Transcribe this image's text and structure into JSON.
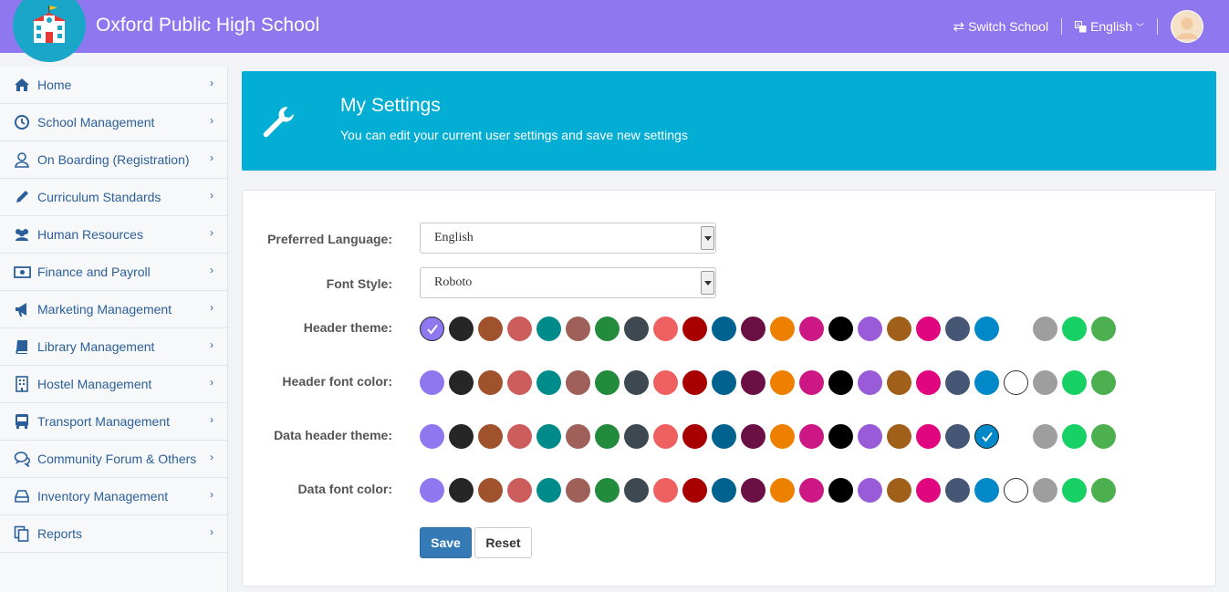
{
  "header": {
    "school_name": "Oxford Public High School",
    "switch_school": "Switch School",
    "language": "English"
  },
  "sidebar": {
    "items": [
      {
        "label": "Home",
        "icon": "home-icon"
      },
      {
        "label": "School Management",
        "icon": "clock-icon"
      },
      {
        "label": "On Boarding (Registration)",
        "icon": "user-icon"
      },
      {
        "label": "Curriculum Standards",
        "icon": "pencil-icon"
      },
      {
        "label": "Human Resources",
        "icon": "users-icon"
      },
      {
        "label": "Finance and Payroll",
        "icon": "money-icon"
      },
      {
        "label": "Marketing Management",
        "icon": "bullhorn-icon"
      },
      {
        "label": "Library Management",
        "icon": "book-icon"
      },
      {
        "label": "Hostel Management",
        "icon": "building-icon"
      },
      {
        "label": "Transport Management",
        "icon": "bus-icon"
      },
      {
        "label": "Community Forum & Others",
        "icon": "comments-icon"
      },
      {
        "label": "Inventory Management",
        "icon": "hdd-icon"
      },
      {
        "label": "Reports",
        "icon": "copy-icon"
      }
    ]
  },
  "banner": {
    "title": "My Settings",
    "subtitle": "You can edit your current user settings and save new settings"
  },
  "form": {
    "language_label": "Preferred Language:",
    "language_value": "English",
    "font_label": "Font Style:",
    "font_value": "Roboto",
    "rows": [
      {
        "label": "Header theme:",
        "selected": 0,
        "has_white": false
      },
      {
        "label": "Header font color:",
        "selected": -1,
        "has_white": true
      },
      {
        "label": "Data header theme:",
        "selected": 19,
        "has_white": false
      },
      {
        "label": "Data font color:",
        "selected": -1,
        "has_white": true
      }
    ],
    "save_label": "Save",
    "reset_label": "Reset"
  },
  "palette": [
    "#8f78ef",
    "#262626",
    "#a0522d",
    "#cd5c5c",
    "#008b8b",
    "#a0605a",
    "#228b3c",
    "#3d4850",
    "#ef6060",
    "#a80000",
    "#00628f",
    "#6b1045",
    "#ee8000",
    "#cc1785",
    "#000000",
    "#9a5bd8",
    "#a0601a",
    "#e0067f",
    "#465775",
    "#0088c8",
    "#ffffff",
    "#9e9e9e",
    "#18d165",
    "#4caf50"
  ],
  "colors": {
    "topbar": "#8f78ef",
    "banner": "#03aed4",
    "link": "#2b5f9a",
    "save": "#337ab7"
  }
}
